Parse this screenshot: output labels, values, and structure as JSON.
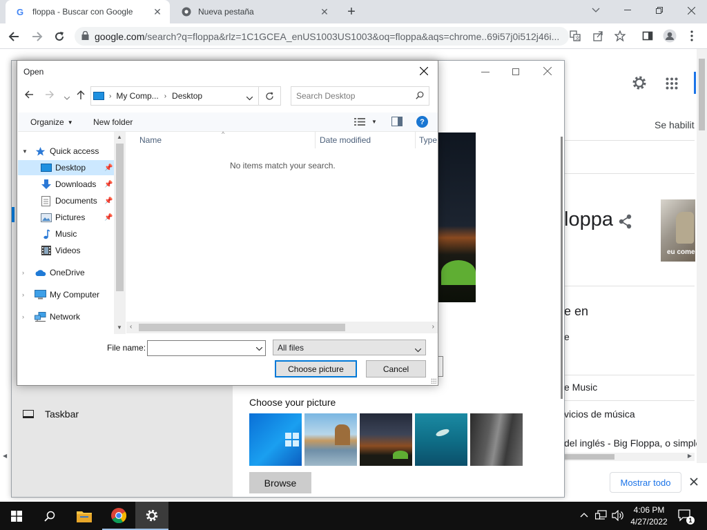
{
  "browser": {
    "tabs": [
      {
        "title": "floppa - Buscar con Google",
        "favicon": "google-g-icon"
      },
      {
        "title": "Nueva pestaña",
        "favicon": "chrome-icon"
      }
    ],
    "new_tab_label": "+",
    "url_domain": "google.com",
    "url_rest": "/search?q=floppa&rlz=1C1GCEA_enUS1003US1003&oq=floppa&aqs=chrome..69i57j0i512j46i..."
  },
  "google_page": {
    "settings_snippet": "Se habilit",
    "entity_title": "loppa",
    "thumb_caption": "eu come",
    "section_heading": "e en",
    "line_1": "e",
    "music_link": "e Music",
    "services_text": "vicios de música",
    "description": "del inglés - Big Floppa, o simple",
    "show_all_button": "Mostrar todo"
  },
  "settings_window": {
    "taskbar_item": "Taskbar",
    "choose_picture_label": "Choose your picture",
    "browse_button": "Browse"
  },
  "dialog": {
    "title": "Open",
    "address": {
      "root": "My Comp...",
      "current": "Desktop"
    },
    "search_placeholder": "Search Desktop",
    "organize_label": "Organize",
    "new_folder_label": "New folder",
    "nav": {
      "quick_access": "Quick access",
      "desktop": "Desktop",
      "downloads": "Downloads",
      "documents": "Documents",
      "pictures": "Pictures",
      "music": "Music",
      "videos": "Videos",
      "onedrive": "OneDrive",
      "my_computer": "My Computer",
      "network": "Network"
    },
    "columns": {
      "name": "Name",
      "date_modified": "Date modified",
      "type": "Type"
    },
    "empty_message": "No items match your search.",
    "file_name_label": "File name:",
    "file_name_value": "",
    "file_type": "All files",
    "choose_button": "Choose picture",
    "cancel_button": "Cancel"
  },
  "taskbar": {
    "time": "4:06 PM",
    "date": "4/27/2022",
    "notification_count": "1"
  },
  "colors": {
    "windows_accent": "#0078d7",
    "chrome_tabstrip": "#dee1e6",
    "google_blue": "#1a73e8",
    "taskbar": "#101010"
  }
}
